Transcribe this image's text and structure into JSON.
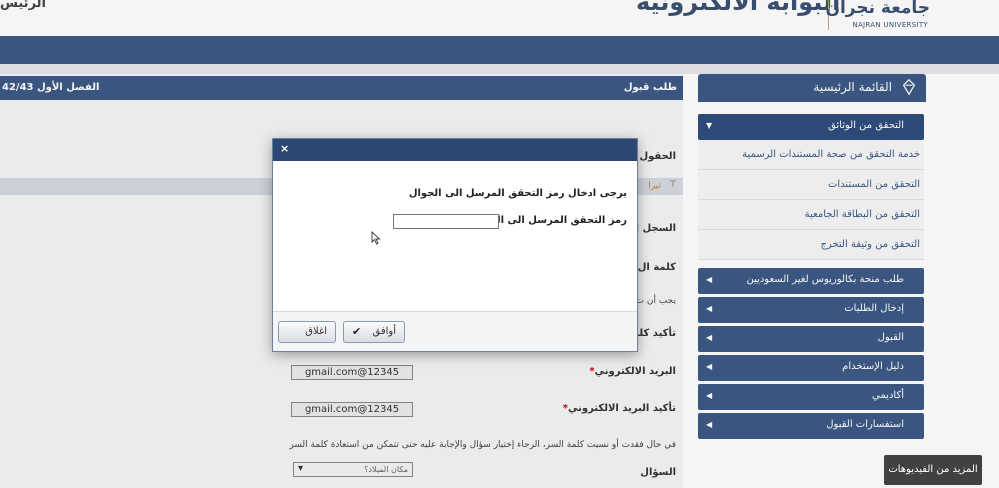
{
  "header": {
    "title_left": "الرئيس",
    "portal_title": "البوابة الالكترونية",
    "logo_ar": "جامعة نجران",
    "logo_en": "NAJRAN UNIVERSITY"
  },
  "panel": {
    "title": "طلب قبول",
    "term": "الفصل الأول 42/43"
  },
  "form": {
    "labels": {
      "fields": "الحقول ال",
      "record": "السجل ال",
      "password": "كلمة ال",
      "must": "يجب أن ت",
      "confirm": "تأكيد كلمة",
      "email": "البريد الالكتروني",
      "confirm_email": "تأكيد البريد الالكتروني",
      "question": "السؤال"
    },
    "email_value": "gmail.com@12345",
    "confirm_email_value": "gmail.com@12345",
    "forgot_note": "في حال فقدت أو نسيت كلمة السر، الرجاء إختيار سؤال والإجابة عليه حتى تتمكن من استعادة كلمة السر",
    "question_select": "مكان الميلاد؟",
    "selected_row_text": "تيرا"
  },
  "sidebar": {
    "title": "القائمة الرئيسية",
    "items": [
      {
        "label": "التحقق من الوثائق",
        "open": true
      },
      {
        "label": "طلب منحة بكالوريوس لغير السعوديين"
      },
      {
        "label": "إدخال الطلبات"
      },
      {
        "label": "القبول"
      },
      {
        "label": "دليل الإستخدام"
      },
      {
        "label": "أكاديمي"
      },
      {
        "label": "استفسارات القبول"
      }
    ],
    "subitems": [
      "خدمة التحقق من صحة المستندات الرسمية",
      "التحقق من المستندات",
      "التحقق من البطاقة الجامعية",
      "التحقق من وثيقة التخرج"
    ]
  },
  "dialog": {
    "close_glyph": "×",
    "message": "يرجى ادخال رمز التحقق المرسل الى الجوال",
    "code_label": "رمز التحقق المرسل الى الجوال",
    "code_value": "",
    "ok_label": "أوافق",
    "ok_icon": "check-icon",
    "cancel_label": "اغلاق"
  },
  "overlay_button": {
    "label": "المزيد من الفيديوهات"
  }
}
